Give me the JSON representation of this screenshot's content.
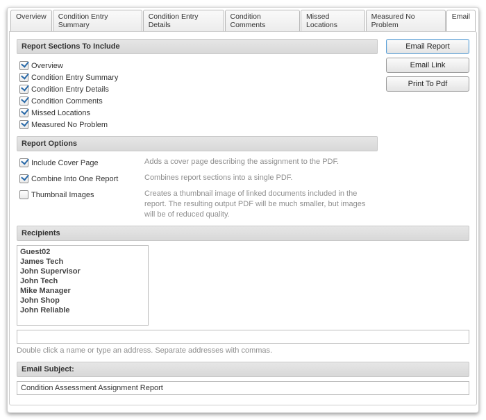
{
  "tabs": {
    "items": [
      {
        "label": "Overview"
      },
      {
        "label": "Condition Entry Summary"
      },
      {
        "label": "Condition Entry Details"
      },
      {
        "label": "Condition Comments"
      },
      {
        "label": "Missed Locations"
      },
      {
        "label": "Measured No Problem"
      },
      {
        "label": "Email"
      }
    ],
    "activeIndex": 6
  },
  "buttons": {
    "emailReport": "Email Report",
    "emailLink": "Email Link",
    "printPdf": "Print To Pdf"
  },
  "sectionsHeader": "Report Sections To Include",
  "sections": [
    {
      "label": "Overview",
      "checked": true
    },
    {
      "label": "Condition Entry Summary",
      "checked": true
    },
    {
      "label": "Condition Entry Details",
      "checked": true
    },
    {
      "label": "Condition Comments",
      "checked": true
    },
    {
      "label": "Missed Locations",
      "checked": true
    },
    {
      "label": "Measured No Problem",
      "checked": true
    }
  ],
  "optionsHeader": "Report Options",
  "options": [
    {
      "label": "Include Cover Page",
      "checked": true,
      "desc": "Adds a cover page describing the assignment to the PDF."
    },
    {
      "label": "Combine Into One Report",
      "checked": true,
      "desc": "Combines report sections into a single PDF."
    },
    {
      "label": "Thumbnail Images",
      "checked": false,
      "desc": "Creates a thumbnail image of linked documents included in the report. The resulting output PDF will be much smaller, but images will be of reduced quality."
    }
  ],
  "recipientsHeader": "Recipients",
  "recipients": [
    "Guest02",
    "James Tech",
    "John Supervisor",
    "John Tech",
    "Mike Manager",
    "John Shop",
    "John Reliable"
  ],
  "addressInputValue": "",
  "recipientsHint": "Double click a name or type an address. Separate addresses with commas.",
  "subjectHeader": "Email Subject:",
  "subjectValue": "Condition Assessment Assignment Report"
}
